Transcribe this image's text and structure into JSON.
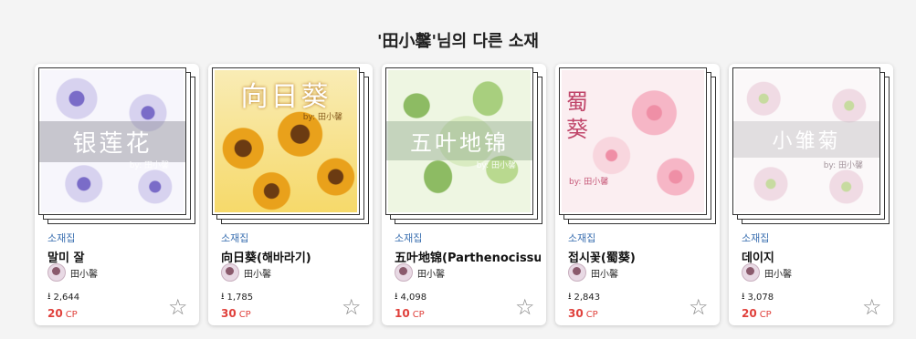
{
  "section": {
    "title": "'田小馨'님의 다른 소재"
  },
  "cards": [
    {
      "category": "소재집",
      "title": "말미 잘",
      "author": "田小馨",
      "downloads": "2,644",
      "price": "20",
      "unit": "CP",
      "art_title": "银莲花",
      "art_by": "by: 田小馨",
      "colors": [
        "#d7d2ef",
        "#7a6cc8",
        "#f7f6fc"
      ]
    },
    {
      "category": "소재집",
      "title": "向日葵(해바라기)",
      "author": "田小馨",
      "downloads": "1,785",
      "price": "30",
      "unit": "CP",
      "art_title": "向日葵",
      "art_by": "by: 田小馨",
      "colors": [
        "#f6d96a",
        "#e9a11b",
        "#f9ecb5"
      ]
    },
    {
      "category": "소재집",
      "title": "五叶地锦(Parthenocissus",
      "author": "田小馨",
      "downloads": "4,098",
      "price": "10",
      "unit": "CP",
      "art_title": "五叶地锦",
      "art_by": "by: 田小馨",
      "colors": [
        "#d9ebc1",
        "#8dbb63",
        "#eef6e2"
      ]
    },
    {
      "category": "소재집",
      "title": "접시꽃(蜀葵)",
      "author": "田小馨",
      "downloads": "2,843",
      "price": "30",
      "unit": "CP",
      "art_title": "蜀葵",
      "art_by": "by: 田小馨",
      "colors": [
        "#f8d6de",
        "#ef8fa6",
        "#fbeef1"
      ]
    },
    {
      "category": "소재집",
      "title": "데이지",
      "author": "田小馨",
      "downloads": "3,078",
      "price": "20",
      "unit": "CP",
      "art_title": "小雏菊",
      "art_by": "by: 田小馨",
      "colors": [
        "#f3eef1",
        "#c7dba0",
        "#fbf8f9"
      ]
    }
  ],
  "icons": {
    "download": "download-icon",
    "favorite": "star-outline-icon"
  }
}
